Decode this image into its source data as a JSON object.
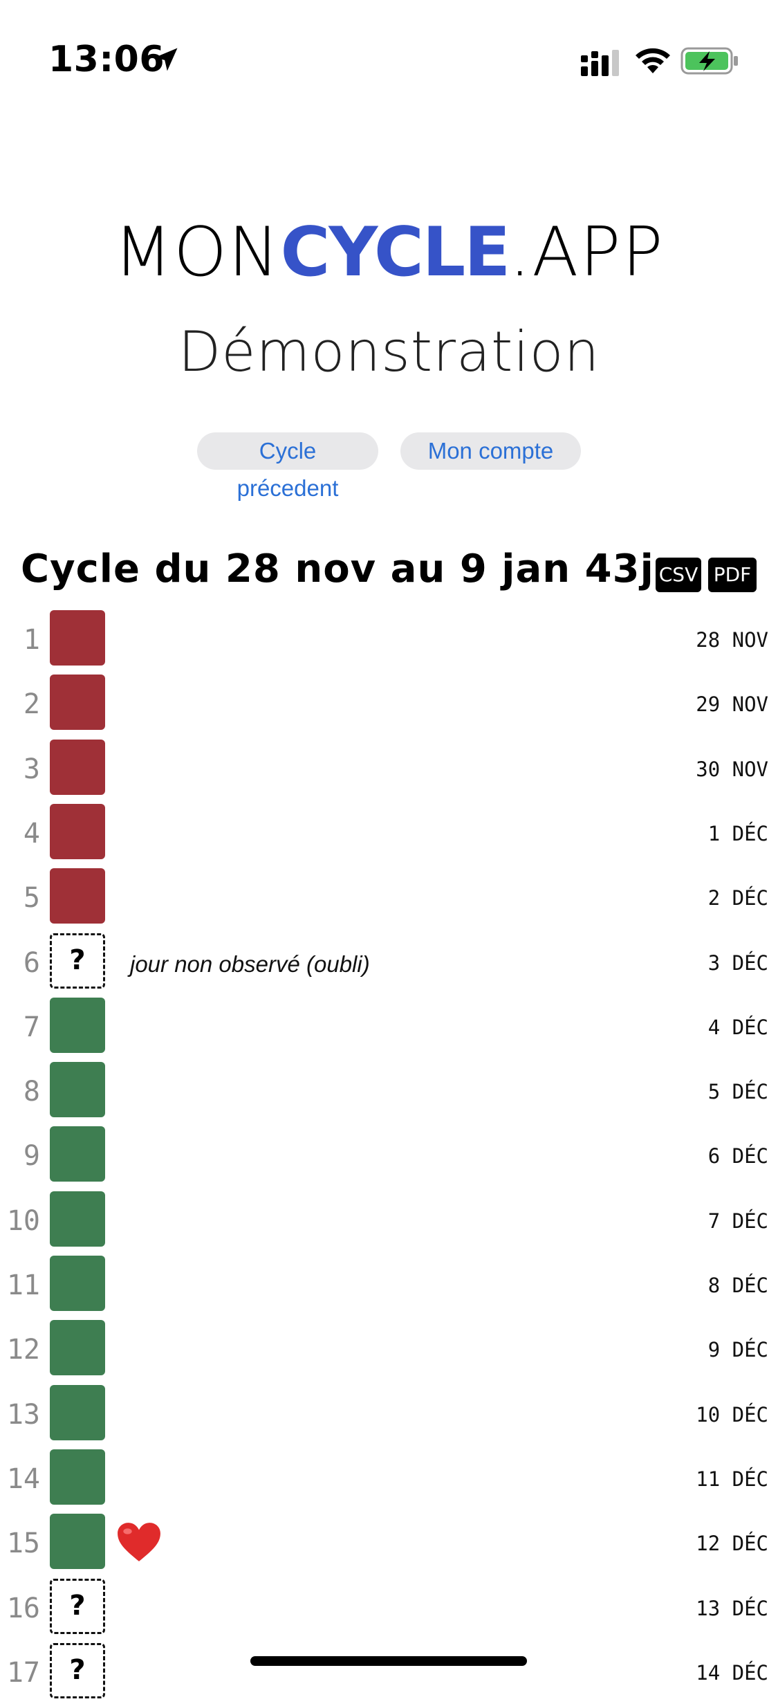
{
  "status_bar": {
    "time": "13:06",
    "icons": [
      "location-arrow-icon",
      "signal-icon",
      "wifi-icon",
      "battery-charging-icon"
    ]
  },
  "header": {
    "logo_mon": "MON",
    "logo_cycle": "CYCLE",
    "logo_app": ".APP",
    "subtitle": "Démonstration",
    "brand_color": "#3653c8"
  },
  "nav": {
    "previous_cycle": "Cycle précedent",
    "my_account": "Mon compte"
  },
  "cycle": {
    "title": "Cycle du 28 nov au 9 jan 43j",
    "export_csv": "CSV",
    "export_pdf": "PDF"
  },
  "colors": {
    "period": "#9f3037",
    "dry": "#3e7e51",
    "link": "#2b70d6"
  },
  "days": [
    {
      "num": "1",
      "type": "red",
      "date": "28 NOV",
      "note": ""
    },
    {
      "num": "2",
      "type": "red",
      "date": "29 NOV",
      "note": ""
    },
    {
      "num": "3",
      "type": "red",
      "date": "30 NOV",
      "note": ""
    },
    {
      "num": "4",
      "type": "red",
      "date": "1 DÉC",
      "note": ""
    },
    {
      "num": "5",
      "type": "red",
      "date": "2 DÉC",
      "note": ""
    },
    {
      "num": "6",
      "type": "unknown",
      "date": "3 DÉC",
      "note": "jour non observé (oubli)"
    },
    {
      "num": "7",
      "type": "green",
      "date": "4 DÉC",
      "note": ""
    },
    {
      "num": "8",
      "type": "green",
      "date": "5 DÉC",
      "note": ""
    },
    {
      "num": "9",
      "type": "green",
      "date": "6 DÉC",
      "note": ""
    },
    {
      "num": "10",
      "type": "green",
      "date": "7 DÉC",
      "note": ""
    },
    {
      "num": "11",
      "type": "green",
      "date": "8 DÉC",
      "note": ""
    },
    {
      "num": "12",
      "type": "green",
      "date": "9 DÉC",
      "note": ""
    },
    {
      "num": "13",
      "type": "green",
      "date": "10 DÉC",
      "note": ""
    },
    {
      "num": "14",
      "type": "green",
      "date": "11 DÉC",
      "note": ""
    },
    {
      "num": "15",
      "type": "green",
      "date": "12 DÉC",
      "note": "",
      "heart": true
    },
    {
      "num": "16",
      "type": "unknown",
      "date": "13 DÉC",
      "note": ""
    },
    {
      "num": "17",
      "type": "unknown",
      "date": "14 DÉC",
      "note": ""
    }
  ],
  "unknown_symbol": "?"
}
